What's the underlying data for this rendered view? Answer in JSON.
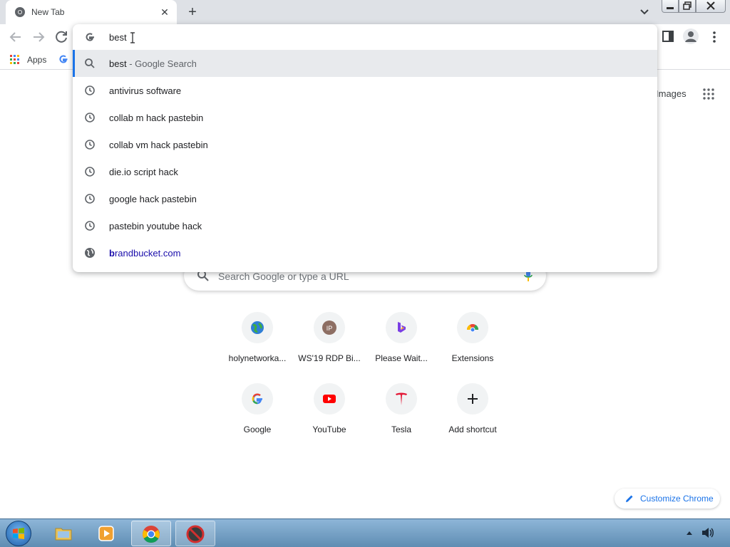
{
  "tab": {
    "title": "New Tab",
    "close": "✕"
  },
  "newtab": "+",
  "bookmarks": {
    "apps_label": "Apps"
  },
  "omnibox": {
    "input_value": "best",
    "suggestions": [
      {
        "type": "search",
        "query": "best",
        "suffix": " - Google Search"
      },
      {
        "type": "history",
        "text": "antivirus software"
      },
      {
        "type": "history",
        "text": "collab m hack pastebin"
      },
      {
        "type": "history",
        "text": "collab vm hack pastebin"
      },
      {
        "type": "history",
        "text": "die.io script hack"
      },
      {
        "type": "history",
        "text": "google hack pastebin"
      },
      {
        "type": "history",
        "text": "pastebin youtube hack"
      },
      {
        "type": "url",
        "bold": "b",
        "rest": "randbucket.com"
      }
    ]
  },
  "ntp": {
    "images_link": "Images",
    "search_placeholder": "Search Google or type a URL",
    "shortcuts": [
      {
        "label": "holynetworka...",
        "icon": "globe-icon"
      },
      {
        "label": "WS'19 RDP Bi...",
        "icon": "ip-icon"
      },
      {
        "label": "Please Wait...",
        "icon": "bing-icon"
      },
      {
        "label": "Extensions",
        "icon": "chrome-icon"
      },
      {
        "label": "Google",
        "icon": "google-icon"
      },
      {
        "label": "YouTube",
        "icon": "youtube-icon"
      },
      {
        "label": "Tesla",
        "icon": "tesla-icon"
      },
      {
        "label": "Add shortcut",
        "icon": "plus-icon"
      }
    ],
    "customize_label": "Customize Chrome"
  },
  "colors": {
    "accent": "#1a73e8",
    "selected_row": "#e8eaed",
    "taskbar": "#6e9cc4"
  }
}
